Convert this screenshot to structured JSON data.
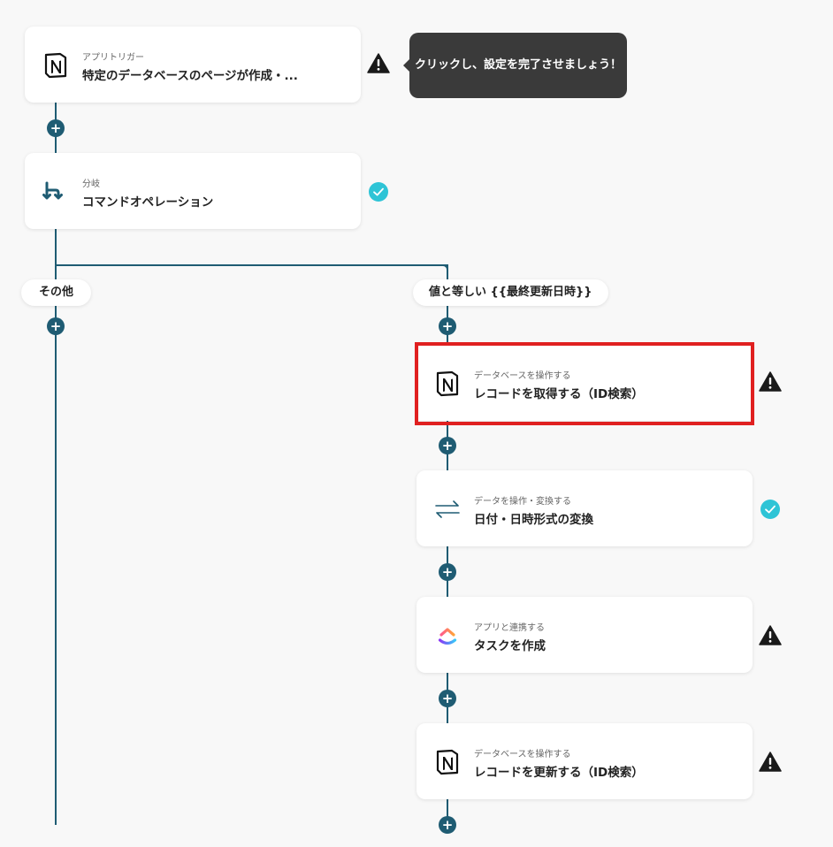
{
  "tooltip": {
    "text": "クリックし、設定を完了させましょう！"
  },
  "trigger": {
    "category": "アプリトリガー",
    "title": "特定のデータベースのページが作成・..."
  },
  "branch": {
    "category": "分岐",
    "title": "コマンドオペレーション",
    "other_label": "その他",
    "condition_label": "値と等しい {{最終更新日時}}"
  },
  "steps": [
    {
      "category": "データベースを操作する",
      "title": "レコードを取得する（ID検索）",
      "status": "warning",
      "icon": "notion-icon"
    },
    {
      "category": "データを操作・変換する",
      "title": "日付・日時形式の変換",
      "status": "ok",
      "icon": "transform-icon"
    },
    {
      "category": "アプリと連携する",
      "title": "タスクを作成",
      "status": "warning",
      "icon": "clickup-icon"
    },
    {
      "category": "データベースを操作する",
      "title": "レコードを更新する（ID検索）",
      "status": "warning",
      "icon": "notion-icon"
    }
  ],
  "colors": {
    "line": "#1f5c73",
    "warning": "#1a1a1a",
    "ok": "#2ec4d6",
    "highlight": "#e02020"
  }
}
